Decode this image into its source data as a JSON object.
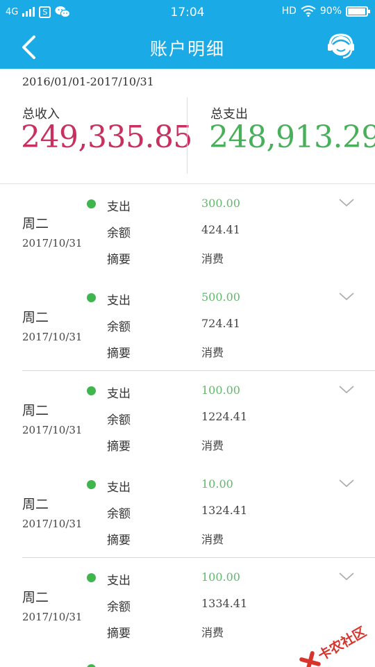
{
  "status_bar": {
    "network": "4G",
    "time": "17:04",
    "hd": "HD",
    "battery": "90%",
    "app_icons": [
      "sim-icon",
      "wechat-icon"
    ]
  },
  "nav": {
    "title": "账户明细",
    "back_icon": "chevron-left-icon",
    "service_icon": "customer-service-icon"
  },
  "summary": {
    "date_range": "2016/01/01-2017/10/31",
    "income_label": "总收入",
    "income_value": "249,335.85",
    "expense_label": "总支出",
    "expense_value": "248,913.29"
  },
  "colors": {
    "primary": "#1aabe6",
    "income": "#c8315f",
    "expense": "#48b05a",
    "dot": "#3fb54d"
  },
  "records": [
    {
      "weekday": "周二",
      "date": "2017/10/31",
      "type_label": "支出",
      "amount": "300.00",
      "balance_label": "余额",
      "balance": "424.41",
      "memo_label": "摘要",
      "memo": "消费"
    },
    {
      "weekday": "周二",
      "date": "2017/10/31",
      "type_label": "支出",
      "amount": "500.00",
      "balance_label": "余额",
      "balance": "724.41",
      "memo_label": "摘要",
      "memo": "消费"
    },
    {
      "weekday": "周二",
      "date": "2017/10/31",
      "type_label": "支出",
      "amount": "100.00",
      "balance_label": "余额",
      "balance": "1224.41",
      "memo_label": "摘要",
      "memo": "消费"
    },
    {
      "weekday": "周二",
      "date": "2017/10/31",
      "type_label": "支出",
      "amount": "10.00",
      "balance_label": "余额",
      "balance": "1324.41",
      "memo_label": "摘要",
      "memo": "消费"
    },
    {
      "weekday": "周二",
      "date": "2017/10/31",
      "type_label": "支出",
      "amount": "100.00",
      "balance_label": "余额",
      "balance": "1334.41",
      "memo_label": "摘要",
      "memo": "消费"
    }
  ],
  "watermark": "卡农社区"
}
